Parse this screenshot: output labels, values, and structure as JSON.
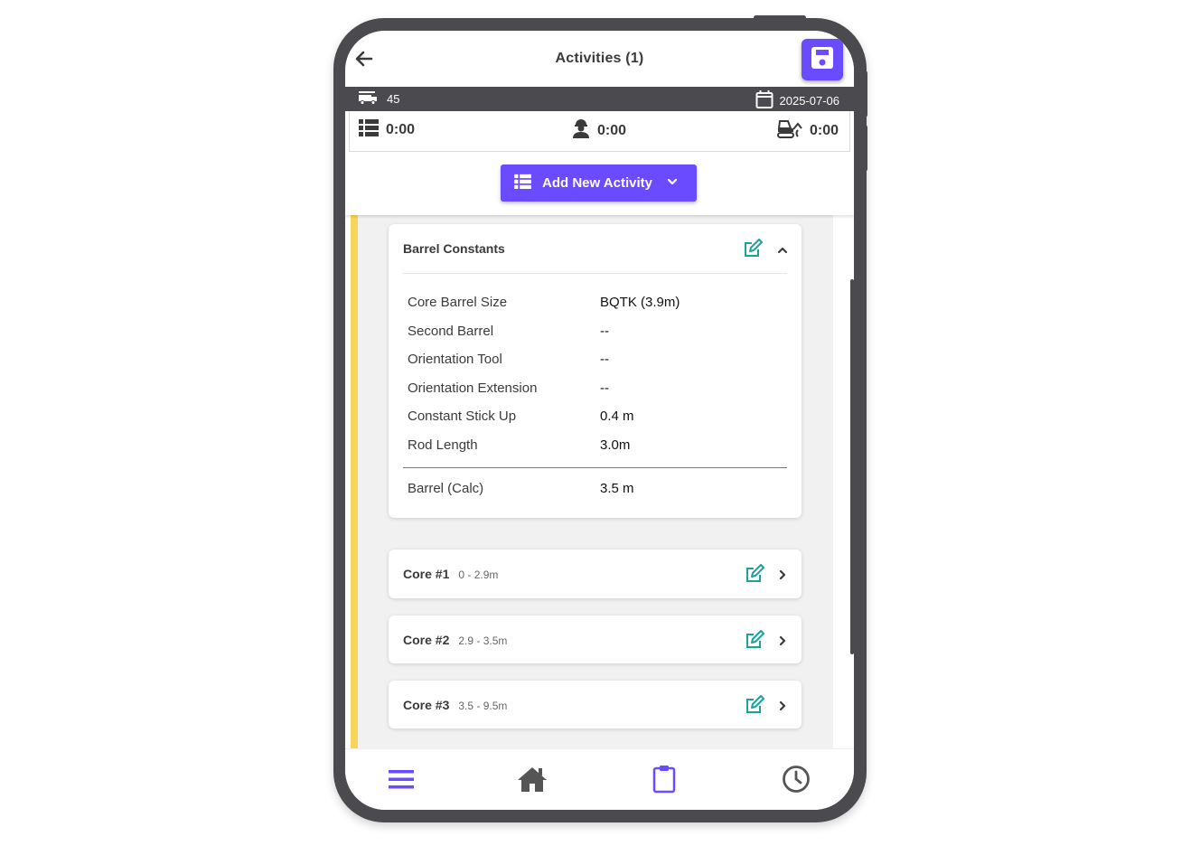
{
  "header": {
    "title": "Activities (1)"
  },
  "infobar": {
    "rig_number": "45",
    "date": "2025-07-06"
  },
  "stats": {
    "activity_time": "0:00",
    "personnel_time": "0:00",
    "equipment_time": "0:00"
  },
  "add_button": {
    "label": "Add New Activity"
  },
  "barrel_constants": {
    "title": "Barrel Constants",
    "rows": [
      {
        "label": "Core Barrel Size",
        "value": "BQTK (3.9m)"
      },
      {
        "label": "Second Barrel",
        "value": "--"
      },
      {
        "label": "Orientation Tool",
        "value": "--"
      },
      {
        "label": "Orientation Extension",
        "value": "--"
      },
      {
        "label": "Constant Stick Up",
        "value": "0.4 m"
      },
      {
        "label": "Rod Length",
        "value": "3.0m"
      }
    ],
    "calc": {
      "label": "Barrel (Calc)",
      "value": "3.5 m"
    }
  },
  "cores": [
    {
      "title": "Core #1",
      "range": "0 - 2.9m"
    },
    {
      "title": "Core #2",
      "range": "2.9 - 3.5m"
    },
    {
      "title": "Core #3",
      "range": "3.5 - 9.5m"
    }
  ],
  "icons": {
    "back": "arrow-left-icon",
    "save": "floppy-disk-icon",
    "truck": "drill-truck-icon",
    "calendar": "calendar-icon",
    "list": "list-icon",
    "worker": "worker-icon",
    "excavator": "excavator-icon",
    "edit": "edit-icon",
    "chevron": "chevron-icon",
    "menu": "menu-icon",
    "home": "home-icon",
    "clipboard": "clipboard-icon",
    "clock": "clock-icon"
  },
  "colors": {
    "accent": "#6a4bff",
    "teal": "#1aa39a",
    "highlight_bar": "#f7d55a",
    "dark": "#4a4a4f"
  }
}
